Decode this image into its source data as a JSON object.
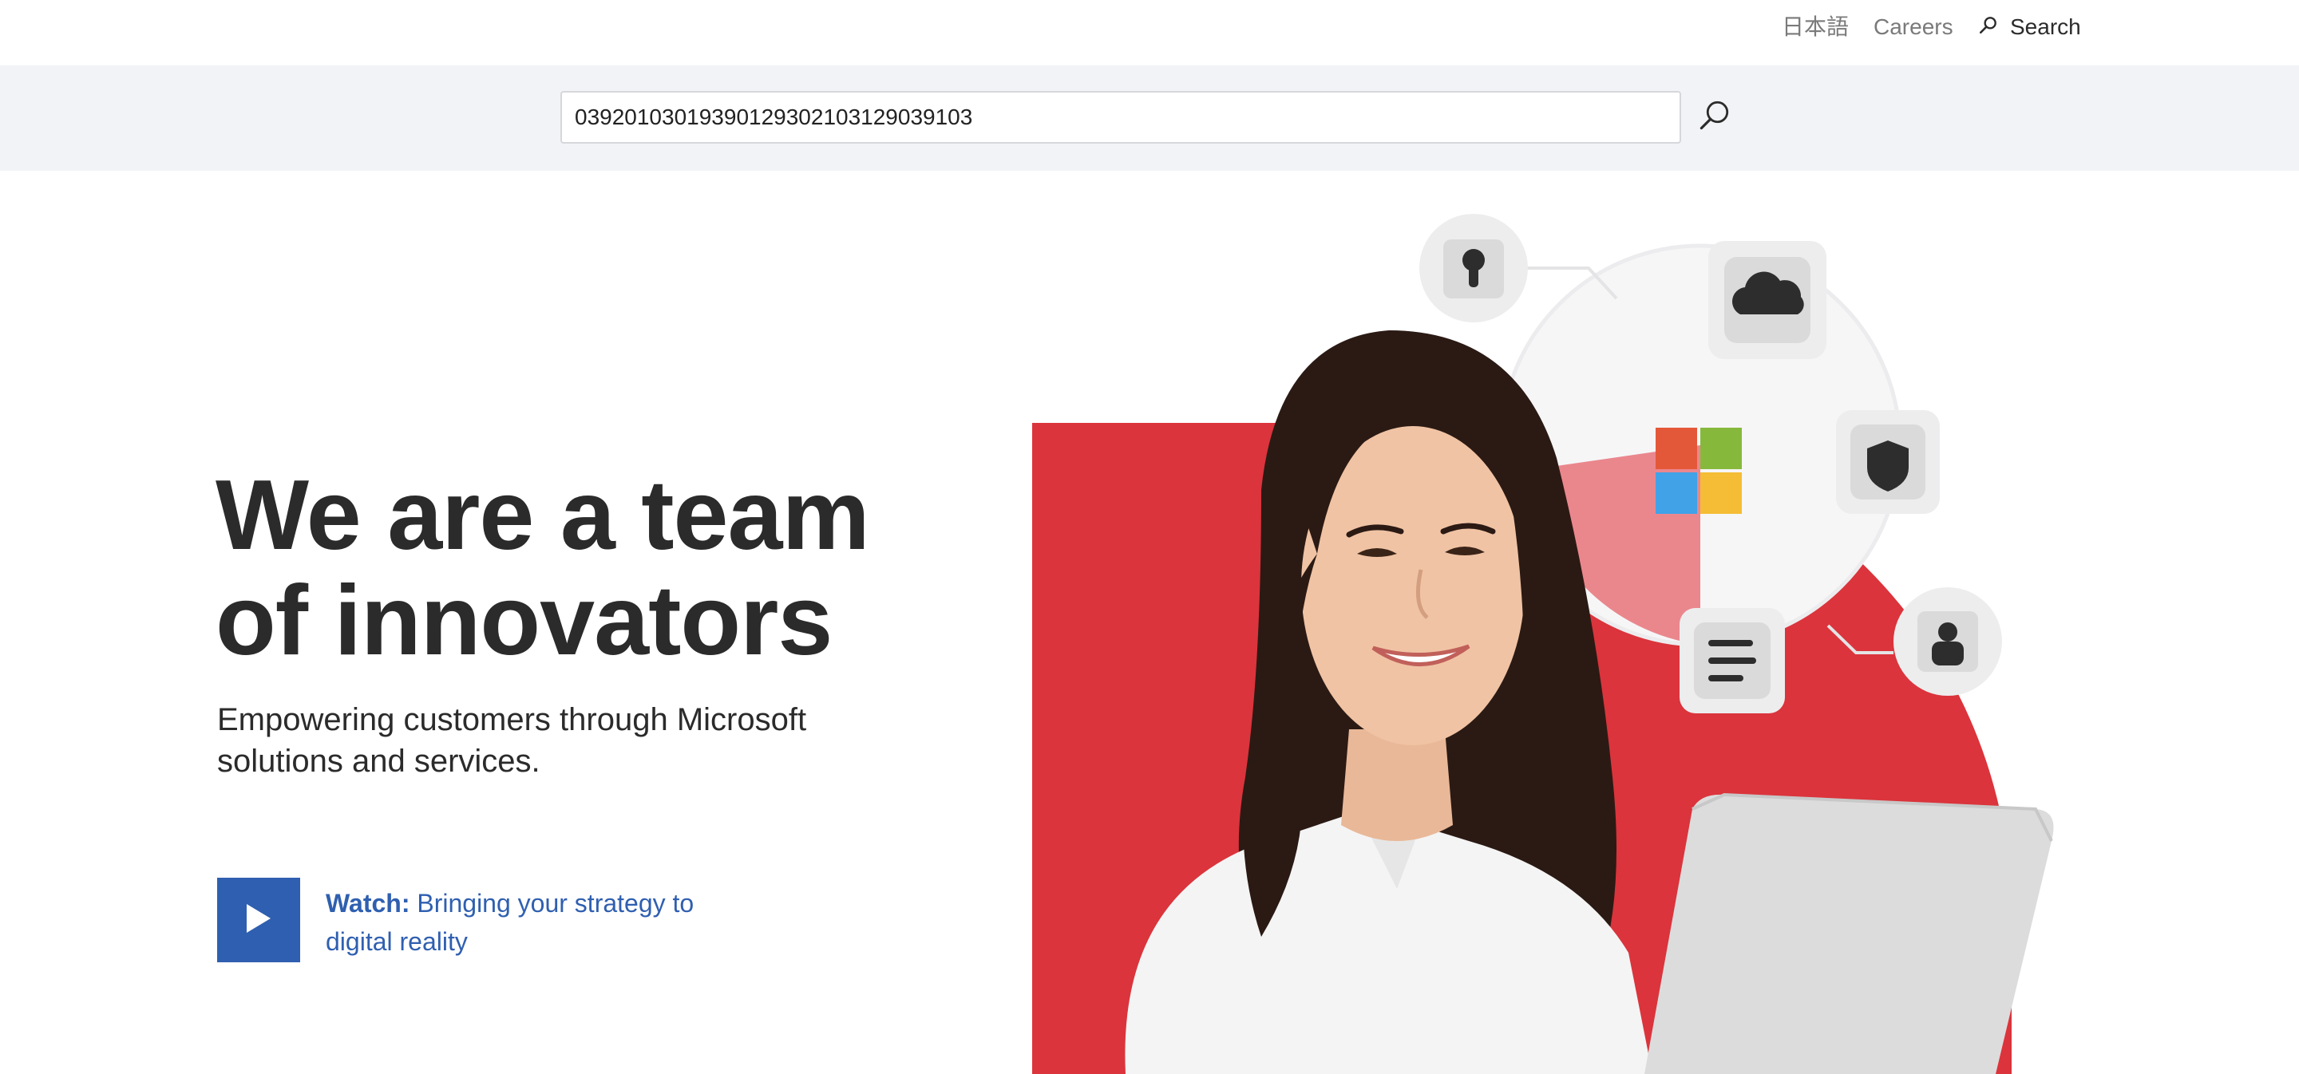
{
  "topbar": {
    "language_link": "日本語",
    "careers_link": "Careers",
    "search_label": "Search"
  },
  "searchbar": {
    "query": "03920103019390129302103129039103"
  },
  "hero": {
    "headline_line1": "We are a team",
    "headline_line2": "of innovators",
    "subheadline_line1": "Empowering customers through Microsoft",
    "subheadline_line2": "solutions and services.",
    "watch_prefix": "Watch:",
    "watch_text": "Bringing your strategy to digital reality"
  },
  "colors": {
    "brand_blue": "#2f5fb0",
    "accent_red": "#db343c",
    "band_gray": "#f2f3f6",
    "text_dark": "#2b2b2b"
  },
  "icons": [
    "search-icon",
    "play-icon",
    "keyhole-icon",
    "cloud-icon",
    "shield-icon",
    "document-lines-icon",
    "user-icon",
    "microsoft-logo"
  ]
}
